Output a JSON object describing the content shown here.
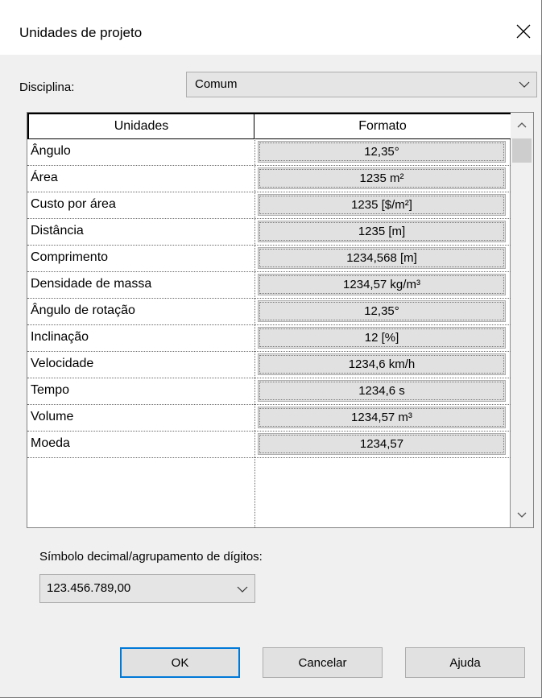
{
  "window": {
    "title": "Unidades de projeto"
  },
  "discipline": {
    "label": "Disciplina:",
    "value": "Comum"
  },
  "table": {
    "headers": {
      "units": "Unidades",
      "format": "Formato"
    },
    "rows": [
      {
        "name": "Ângulo",
        "format": "12,35°"
      },
      {
        "name": "Área",
        "format": "1235 m²"
      },
      {
        "name": "Custo por área",
        "format": "1235 [$/m²]"
      },
      {
        "name": "Distância",
        "format": "1235 [m]"
      },
      {
        "name": "Comprimento",
        "format": "1234,568 [m]"
      },
      {
        "name": "Densidade de massa",
        "format": "1234,57 kg/m³"
      },
      {
        "name": "Ângulo de rotação",
        "format": "12,35°"
      },
      {
        "name": "Inclinação",
        "format": "12 [%]"
      },
      {
        "name": "Velocidade",
        "format": "1234,6 km/h"
      },
      {
        "name": "Tempo",
        "format": "1234,6 s"
      },
      {
        "name": "Volume",
        "format": "1234,57 m³"
      },
      {
        "name": "Moeda",
        "format": "1234,57"
      }
    ]
  },
  "decimal": {
    "label": "Símbolo decimal/agrupamento de dígitos:",
    "value": "123.456.789,00"
  },
  "buttons": {
    "ok": "OK",
    "cancel": "Cancelar",
    "help": "Ajuda"
  },
  "icons": {
    "close": "close-icon",
    "dropdown": "chevron-down-icon",
    "scroll_up": "chevron-up-icon",
    "scroll_down": "chevron-down-icon"
  }
}
